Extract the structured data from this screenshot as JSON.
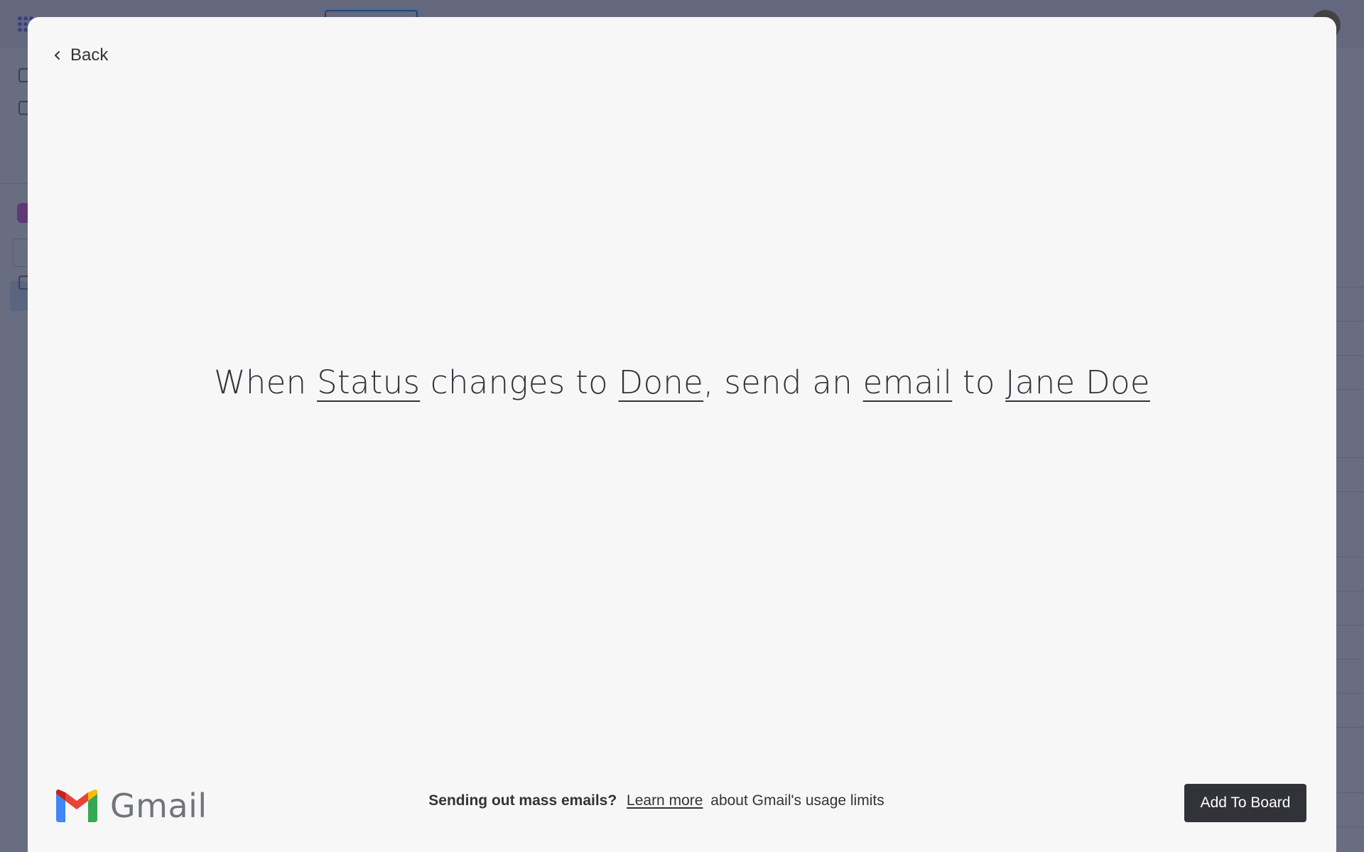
{
  "modal": {
    "back_label": "Back",
    "recipe": {
      "when": "When",
      "trigger_column": "Status",
      "changes_to": "changes to",
      "trigger_value": "Done",
      "comma": ",",
      "send_an": "send an",
      "action_item": "email",
      "to": "to",
      "recipient": "Jane Doe"
    },
    "brand": {
      "name": "Gmail",
      "icon": "gmail-icon",
      "colors": {
        "blue": "#4285f4",
        "red": "#ea4335",
        "yellow": "#fbbc04",
        "green": "#34a853",
        "dark_red": "#c5221f"
      }
    },
    "footer": {
      "bold_text": "Sending out mass emails?",
      "link_text": "Learn more",
      "trailing_text": "about Gmail's usage limits"
    },
    "add_button_label": "Add To Board"
  },
  "colors": {
    "modal_bg": "#f7f7f7",
    "text": "#323338",
    "button_bg": "#323338",
    "button_text": "#ffffff",
    "overlay": "#292f4c"
  }
}
